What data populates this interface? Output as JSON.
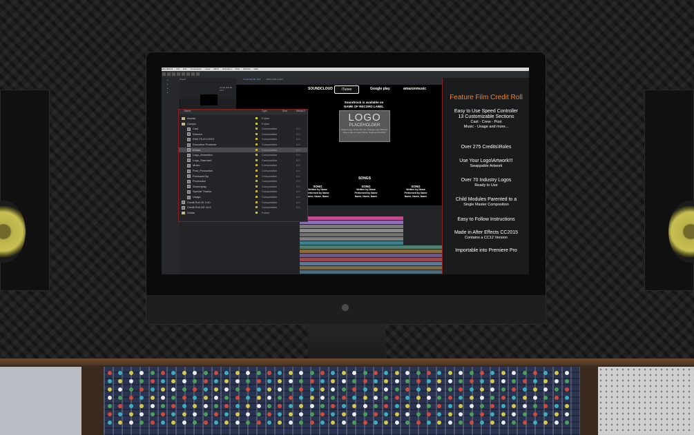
{
  "menubar": [
    "After Effects",
    "File",
    "Edit",
    "Composition",
    "Layer",
    "Effect",
    "Animation",
    "View",
    "Window",
    "Help"
  ],
  "project_panel": {
    "label": "Project",
    "comp_info": "Credit Roll 8K 16:9"
  },
  "comp_tabs": [
    "Credit Roll 8K 16:9",
    "END FILM LOGO"
  ],
  "comp_content": {
    "soundtrack_line1": "Soundtrack is available on",
    "soundtrack_line2": "NAME OF RECORD LABEL",
    "logo_big": "LOGO",
    "logo_mid": "PLACEHOLDER",
    "logo_small": "Select Logo, Press Ctrl Alt / Change Logo With Alt, Drop Logo on Layer Name, Scale and Position",
    "brands": [
      "SOUNDCLOUD",
      "iTunes",
      "Google play",
      "amazonmusic"
    ],
    "songs_header": "SONGS",
    "song_cols": [
      {
        "title": "SONG",
        "line1": "Written by Name",
        "line2": "Performed by Name",
        "line3": "Name, Name, Name"
      },
      {
        "title": "SONG",
        "line1": "Written by Name",
        "line2": "Performed by Name",
        "line3": "Name, Name, Name"
      },
      {
        "title": "SONG",
        "line1": "Written by Name",
        "line2": "Performed by Name",
        "line3": "Name, Name, Name"
      }
    ]
  },
  "project_list": {
    "headers": {
      "name": "Name",
      "type": "Type",
      "size": "Size",
      "media": "Media D"
    },
    "items": [
      {
        "name": "Assets",
        "type": "Folder",
        "kind": "folder",
        "size": ""
      },
      {
        "name": "Comps",
        "type": "Folder",
        "kind": "folder",
        "size": ""
      },
      {
        "name": "Cast",
        "type": "Composition",
        "kind": "comp",
        "size": "0:0"
      },
      {
        "name": "Director",
        "type": "Composition",
        "kind": "comp",
        "size": "0:0"
      },
      {
        "name": "END FILM LOGO",
        "type": "Composition",
        "kind": "comp",
        "size": "0:0"
      },
      {
        "name": "Executive Producer",
        "type": "Composition",
        "kind": "comp",
        "size": "0:0"
      },
      {
        "name": "Extras",
        "type": "Composition",
        "kind": "comp",
        "size": "0:0",
        "selected": true
      },
      {
        "name": "Logo_Animation",
        "type": "Composition",
        "kind": "comp",
        "size": "0:0"
      },
      {
        "name": "Logo_Standard",
        "type": "Composition",
        "kind": "comp",
        "size": "0:0"
      },
      {
        "name": "Music",
        "type": "Composition",
        "kind": "comp",
        "size": "0:0"
      },
      {
        "name": "Post_Production",
        "type": "Composition",
        "kind": "comp",
        "size": "0:0"
      },
      {
        "name": "Produced By",
        "type": "Composition",
        "kind": "comp",
        "size": "0:0"
      },
      {
        "name": "Production",
        "type": "Composition",
        "kind": "comp",
        "size": "0:0"
      },
      {
        "name": "Screenplay",
        "type": "Composition",
        "kind": "comp",
        "size": "0:0"
      },
      {
        "name": "Special Thanks",
        "type": "Composition",
        "kind": "comp",
        "size": "0:0"
      },
      {
        "name": "Usage",
        "type": "Composition",
        "kind": "comp",
        "size": "0:0"
      },
      {
        "name": "Credit Roll 2K 2:40",
        "type": "Composition",
        "kind": "comp",
        "size": "0:0"
      },
      {
        "name": "Credit Roll HD 16:9",
        "type": "Composition",
        "kind": "comp",
        "size": "0:0"
      },
      {
        "name": "Solids",
        "type": "Folder",
        "kind": "folder",
        "size": ""
      }
    ]
  },
  "features": {
    "title": "Feature Film Credit Roll",
    "items": [
      {
        "main": "Easy to Use Speed Controller",
        "sub": ""
      },
      {
        "main": "13 Customizable Sections",
        "sub": "Cast - Crew - Post\nMusic - Usage and more..."
      },
      {
        "main": "Over 275 Credits\\Roles",
        "sub": ""
      },
      {
        "main": "Use Your Logo\\Artwork!!!",
        "sub": "Swappable Artwork"
      },
      {
        "main": "Over 70 Industry Logos",
        "sub": "Ready to Use"
      },
      {
        "main": "Child Modules Parented to a",
        "sub": "Single Master Composition"
      },
      {
        "main": "Easy to Follow Instructions",
        "sub": ""
      },
      {
        "main": "Made in After Effects CC2015",
        "sub": "Contains a CC12 Version"
      },
      {
        "main": "Importable  into Premiere Pro",
        "sub": ""
      }
    ]
  },
  "colors": {
    "accent_title": "#f2862a",
    "border_red": "#8a1f1f",
    "folder": "#d6c94a"
  }
}
